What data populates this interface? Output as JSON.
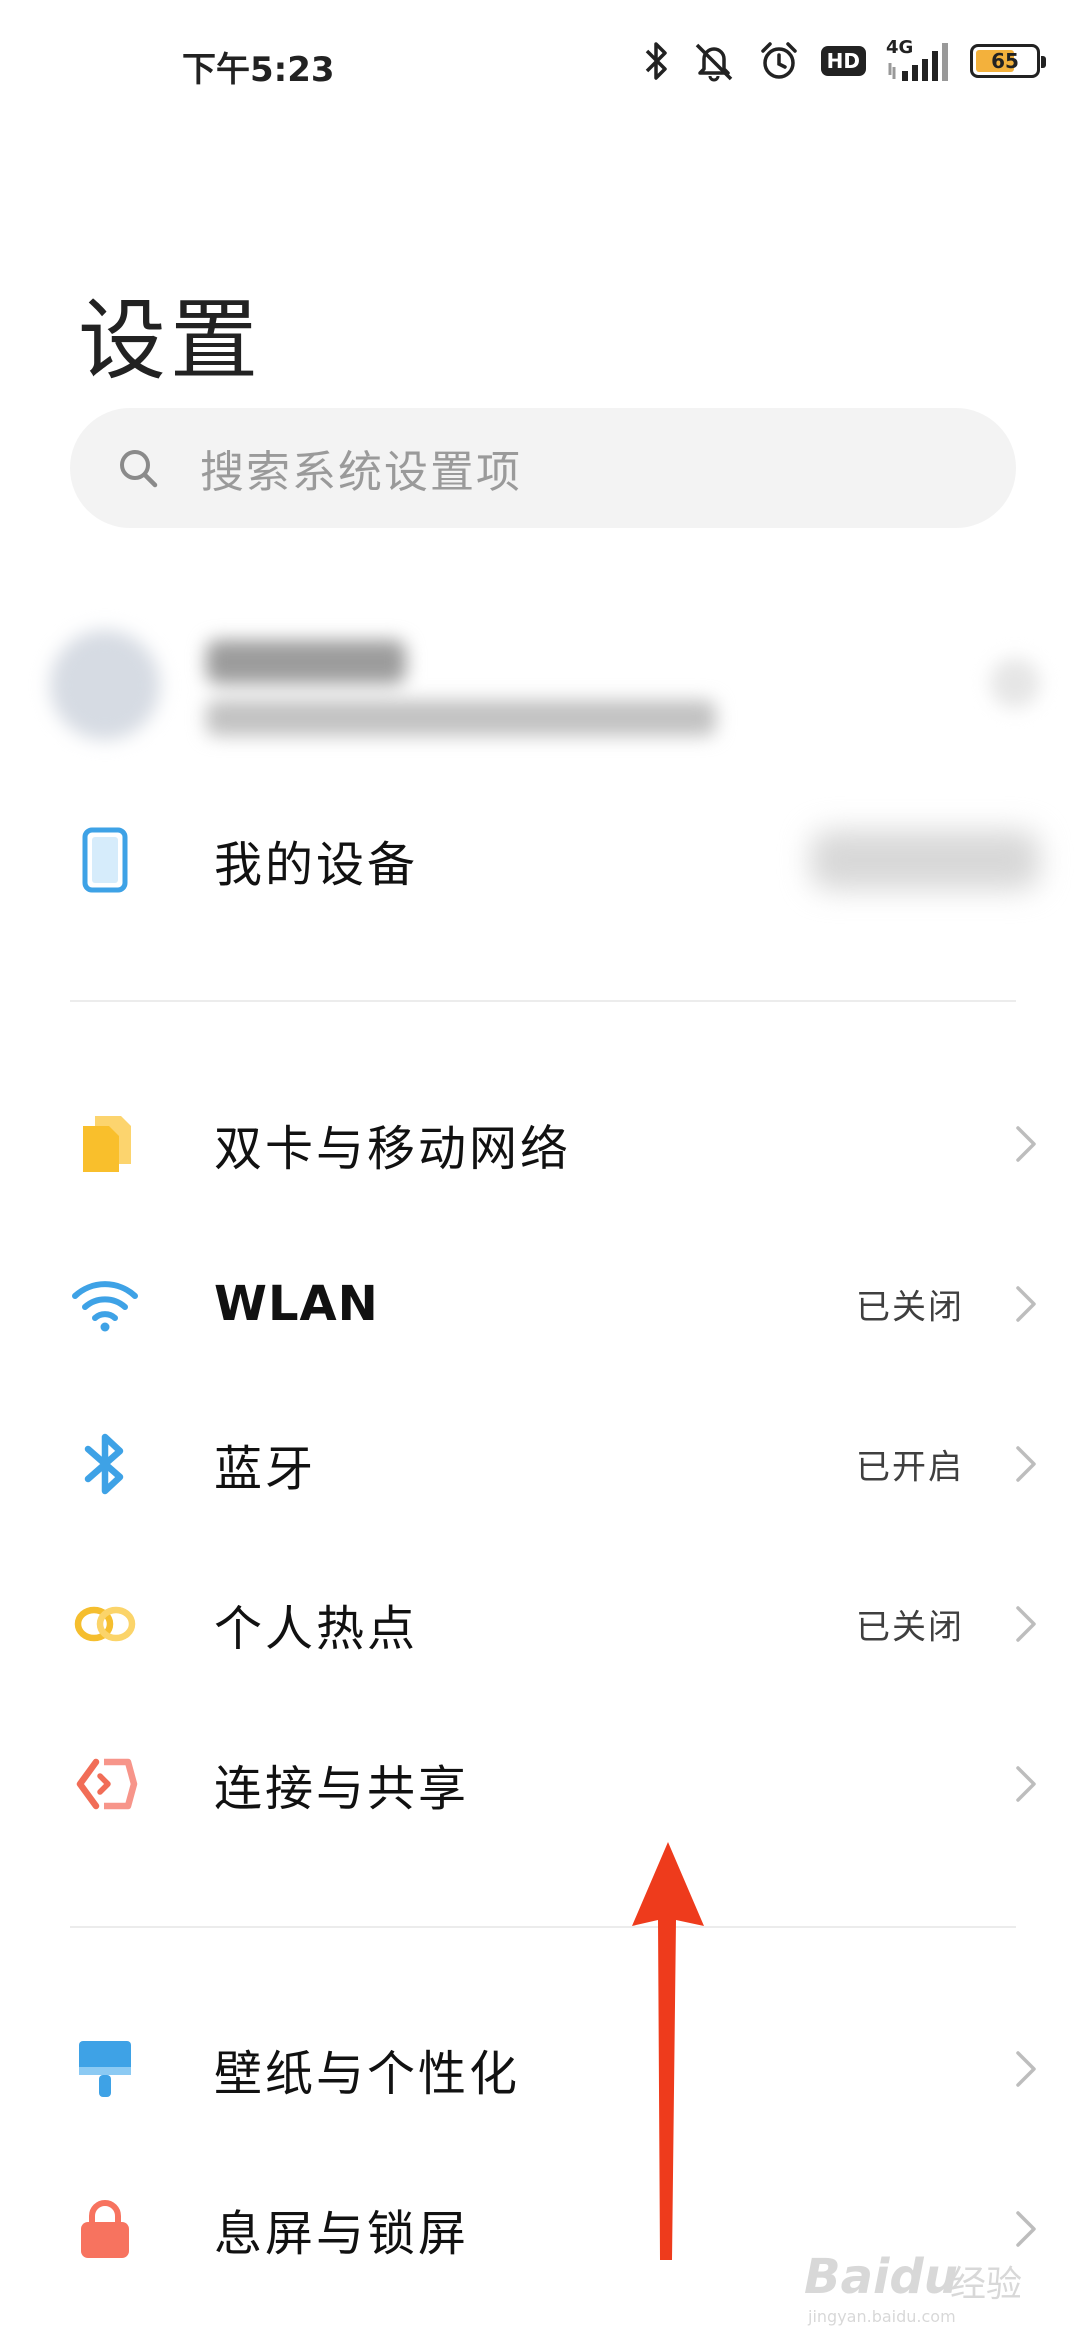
{
  "status_bar": {
    "time": "下午5:23",
    "network_label": "4G",
    "hd_label": "HD",
    "battery_level": "65",
    "battery_fraction": 0.65
  },
  "page": {
    "title": "设置"
  },
  "search": {
    "placeholder": "搜索系统设置项"
  },
  "account": {
    "blurred": true
  },
  "device": {
    "label": "我的设备"
  },
  "connectivity": [
    {
      "id": "sim",
      "label": "双卡与移动网络",
      "status": "",
      "icon": "sim-cards-icon",
      "color": "#f9bf2c"
    },
    {
      "id": "wlan",
      "label": "WLAN",
      "status": "已关闭",
      "icon": "wifi-icon",
      "color": "#3ea2e6"
    },
    {
      "id": "bluetooth",
      "label": "蓝牙",
      "status": "已开启",
      "icon": "bluetooth-icon",
      "color": "#3ea2e6"
    },
    {
      "id": "hotspot",
      "label": "个人热点",
      "status": "已关闭",
      "icon": "hotspot-icon",
      "color": "#f5be2e"
    },
    {
      "id": "share",
      "label": "连接与共享",
      "status": "",
      "icon": "connect-share-icon",
      "color": "#f16d57"
    }
  ],
  "personalization": [
    {
      "id": "wallpaper",
      "label": "壁纸与个性化",
      "icon": "wallpaper-brush-icon",
      "color": "#3ea2e6"
    },
    {
      "id": "lockscreen",
      "label": "息屏与锁屏",
      "icon": "lock-icon",
      "color": "#f7735f"
    }
  ],
  "annotation": {
    "arrow_color": "#ee3b1c",
    "direction": "up"
  },
  "watermark": {
    "brand": "Baidu",
    "text": "经验",
    "url": "jingyan.baidu.com"
  }
}
